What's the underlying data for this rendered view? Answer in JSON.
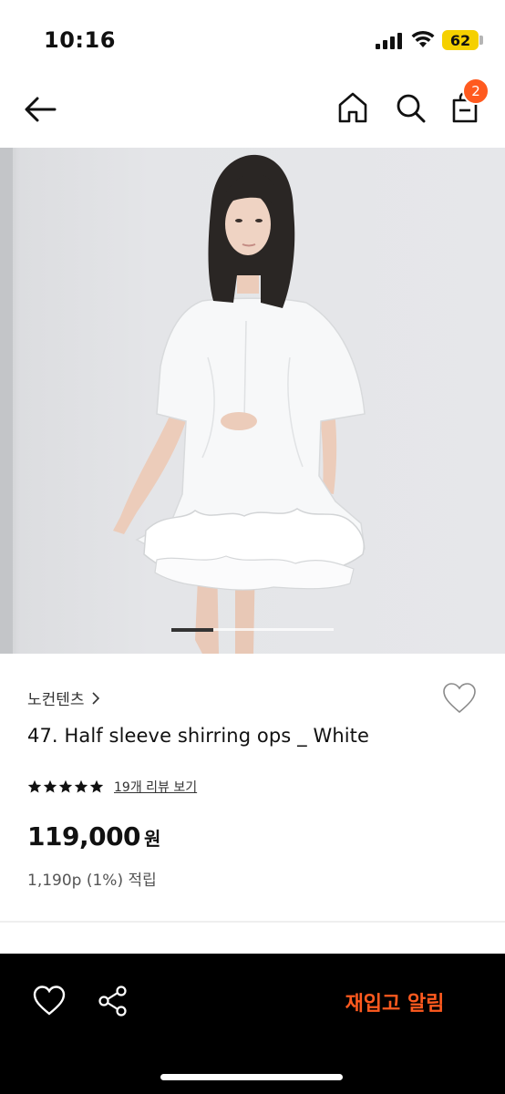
{
  "status_bar": {
    "time": "10:16",
    "battery": "62"
  },
  "nav": {
    "cart_count": "2",
    "icons": [
      "back-arrow-icon",
      "home-icon",
      "search-icon",
      "shopping-bag-icon"
    ]
  },
  "product": {
    "brand": "노컨텐츠",
    "title": "47. Half sleeve shirring ops _ White",
    "rating_stars": 5,
    "review_link": "19개 리뷰 보기",
    "price": "119,000",
    "currency": "원",
    "points": "1,190p (1%) 적립",
    "image_slide": {
      "current": 1,
      "total": 4
    }
  },
  "bottom_bar": {
    "restock_label": "재입고 알림",
    "icons": [
      "heart-icon",
      "share-icon"
    ]
  },
  "colors": {
    "accent": "#ff5a1f",
    "bottom_bar_bg": "#000000",
    "battery": "#f5d000"
  }
}
